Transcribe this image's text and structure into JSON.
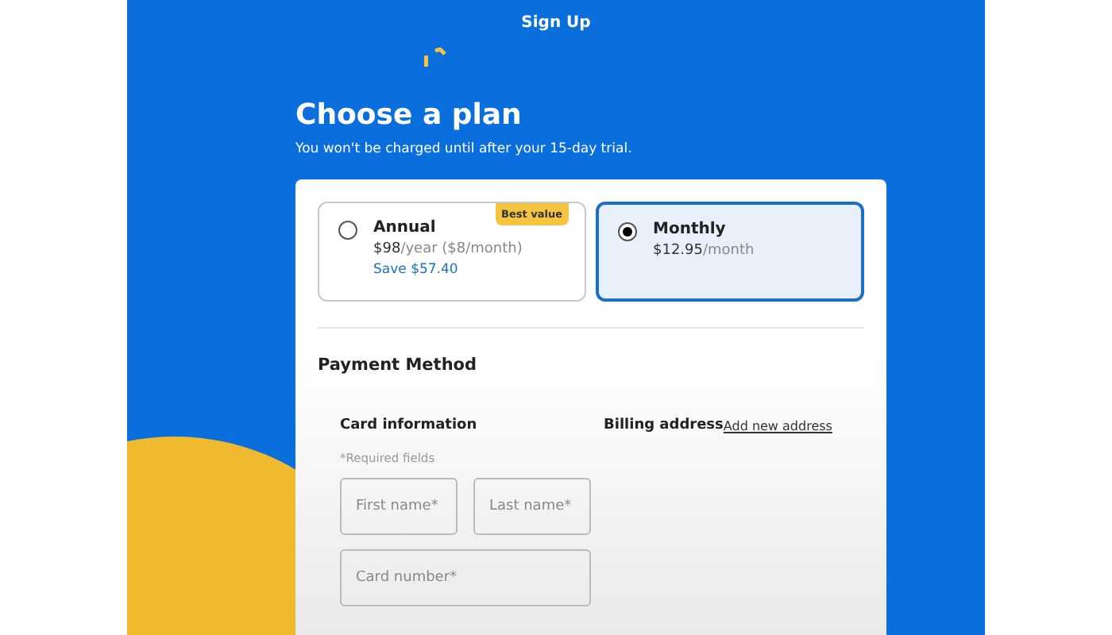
{
  "header": {
    "title": "Sign Up"
  },
  "heading": "Choose a plan",
  "subtitle": "You won't be charged until after your 15-day trial.",
  "plans": [
    {
      "name": "Annual",
      "price": "$98",
      "period": "/year ($8/month)",
      "savings": "Save $57.40",
      "badge": "Best value",
      "selected": false
    },
    {
      "name": "Monthly",
      "price": "$12.95",
      "period": "/month",
      "selected": true
    }
  ],
  "payment": {
    "title": "Payment Method",
    "card_heading": "Card information",
    "billing_heading": "Billing address",
    "add_address_link": "Add new address",
    "required_note": "*Required fields",
    "fields": [
      {
        "placeholder": "First name*",
        "kind": "half"
      },
      {
        "placeholder": "Last name*",
        "kind": "half"
      },
      {
        "placeholder": "Card number*",
        "kind": "full"
      }
    ]
  }
}
